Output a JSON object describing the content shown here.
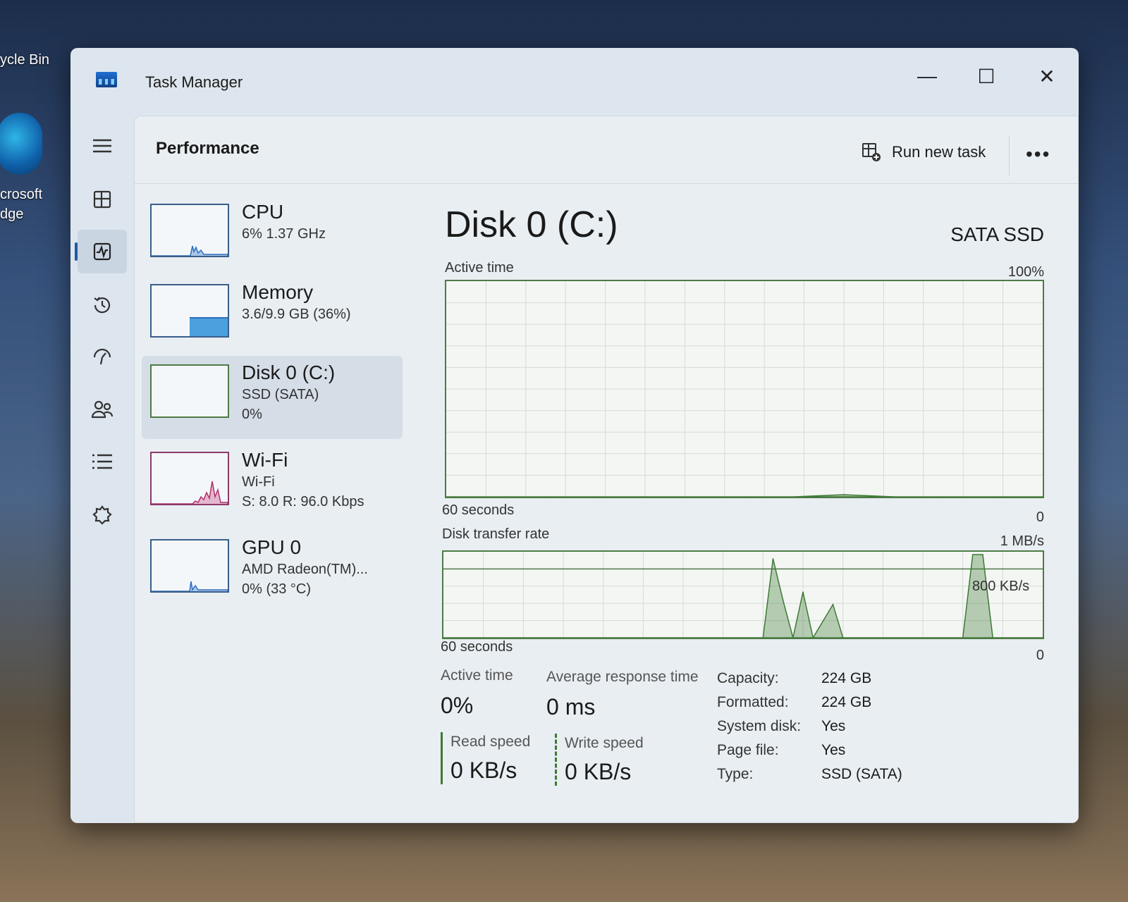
{
  "desktop": {
    "recycle_label": "ycle Bin",
    "edge_label_1": "crosoft",
    "edge_label_2": "dge"
  },
  "window": {
    "title": "Task Manager",
    "minimize": "—",
    "maximize": "☐",
    "close": "✕"
  },
  "nav": {
    "icons": [
      "hamburger-icon",
      "processes-icon",
      "performance-icon",
      "app-history-icon",
      "startup-apps-icon",
      "users-icon",
      "details-icon",
      "services-icon",
      "settings-icon"
    ]
  },
  "header": {
    "title": "Performance",
    "run_new_task": "Run new task",
    "more": "•••"
  },
  "devices": [
    {
      "name": "CPU",
      "line1": "6%  1.37 GHz",
      "line2": ""
    },
    {
      "name": "Memory",
      "line1": "3.6/9.9 GB (36%)",
      "line2": ""
    },
    {
      "name": "Disk 0 (C:)",
      "line1": "SSD (SATA)",
      "line2": "0%"
    },
    {
      "name": "Wi-Fi",
      "line1": "Wi-Fi",
      "line2": "S: 8.0  R: 96.0 Kbps"
    },
    {
      "name": "GPU 0",
      "line1": "AMD Radeon(TM)...",
      "line2": "0%  (33 °C)"
    }
  ],
  "detail": {
    "title": "Disk 0 (C:)",
    "kind": "SATA SSD",
    "active_time_label": "Active time",
    "active_time_max": "100%",
    "active_time_xlabel": "60 seconds",
    "active_time_min": "0",
    "transfer_label": "Disk transfer rate",
    "transfer_max": "1 MB/s",
    "transfer_mid": "800 KB/s",
    "transfer_xlabel": "60 seconds",
    "transfer_min": "0"
  },
  "stats": {
    "active_time_label": "Active time",
    "active_time_value": "0%",
    "avg_response_label": "Average response time",
    "avg_response_value": "0 ms",
    "read_label": "Read speed",
    "read_value": "0 KB/s",
    "write_label": "Write speed",
    "write_value": "0 KB/s"
  },
  "properties": [
    {
      "label": "Capacity:",
      "value": "224 GB"
    },
    {
      "label": "Formatted:",
      "value": "224 GB"
    },
    {
      "label": "System disk:",
      "value": "Yes"
    },
    {
      "label": "Page file:",
      "value": "Yes"
    },
    {
      "label": "Type:",
      "value": "SSD (SATA)"
    }
  ],
  "colors": {
    "accent": "#1e5aa8",
    "disk_green": "#3d7a34",
    "memory_blue": "#4b9fdc",
    "wifi_red": "#b0306a"
  },
  "chart_data": [
    {
      "type": "area",
      "title": "Active time",
      "xlabel": "60 seconds",
      "ylim": [
        0,
        100
      ],
      "x": [
        0,
        5,
        10,
        15,
        20,
        25,
        30,
        35,
        40,
        45,
        50,
        55,
        60
      ],
      "values": [
        0,
        0,
        0,
        0,
        0,
        0,
        0,
        0,
        1,
        0,
        0,
        0,
        0
      ]
    },
    {
      "type": "area",
      "title": "Disk transfer rate",
      "xlabel": "60 seconds",
      "ylim": [
        0,
        1000
      ],
      "x": [
        0,
        32,
        33,
        34,
        35,
        36,
        37,
        39,
        40,
        41,
        44,
        46,
        52,
        53,
        54,
        55,
        56,
        60
      ],
      "values": [
        0,
        0,
        950,
        450,
        0,
        550,
        0,
        400,
        0,
        0,
        0,
        0,
        0,
        1000,
        1000,
        0,
        0,
        0
      ]
    }
  ]
}
